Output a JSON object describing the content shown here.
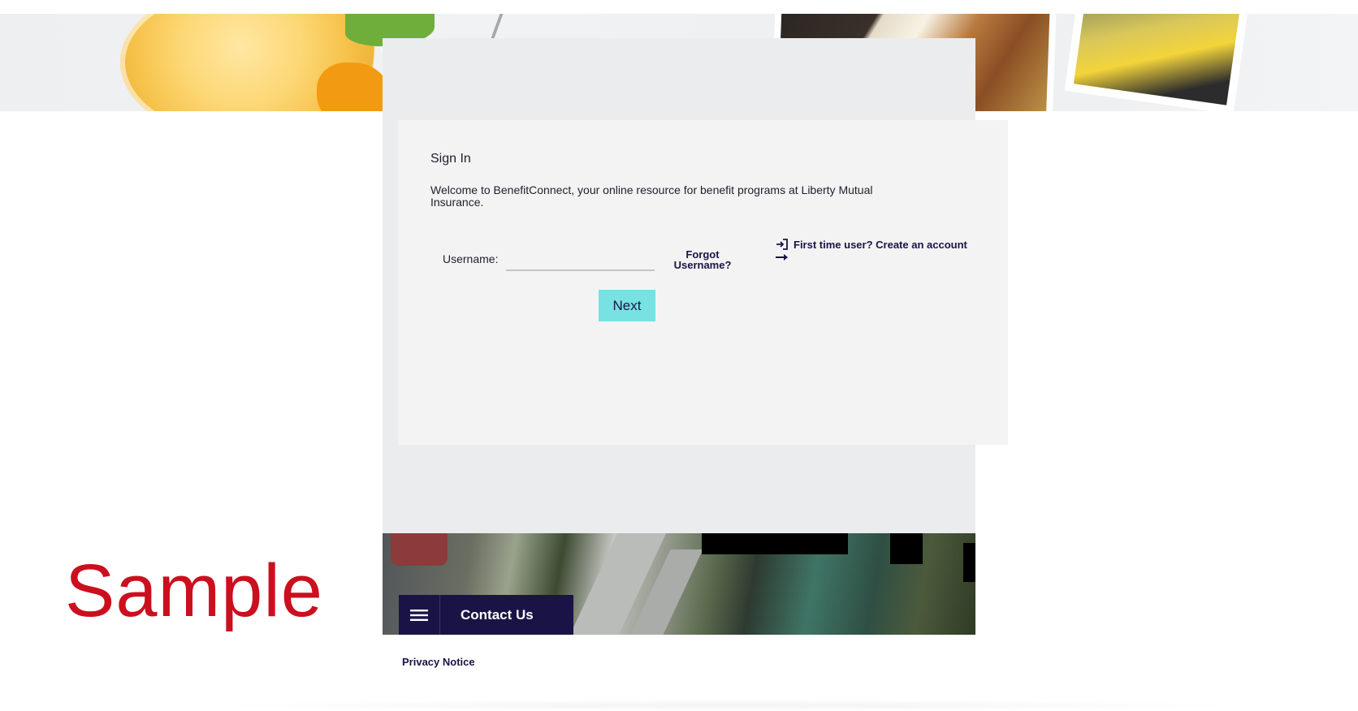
{
  "signin": {
    "title": "Sign In",
    "welcome": "Welcome to BenefitConnect, your online resource for benefit programs at Liberty Mutual Insurance.",
    "username_label": "Username:",
    "username_value": "",
    "forgot_username": "Forgot Username?",
    "create_account": "First time user? Create an account",
    "next_label": "Next"
  },
  "footer": {
    "contact_label": "Contact Us",
    "privacy_label": "Privacy Notice"
  },
  "watermark": "Sample",
  "icons": {
    "menu": "hamburger-menu-icon",
    "login": "login-arrow-icon",
    "arrow": "right-arrow-icon"
  },
  "colors": {
    "brand_navy": "#1a1446",
    "next_button": "#78e1e1",
    "watermark_red": "#cc0f1e",
    "panel_bg": "#f3f3f3",
    "column_bg": "#ebecee"
  }
}
